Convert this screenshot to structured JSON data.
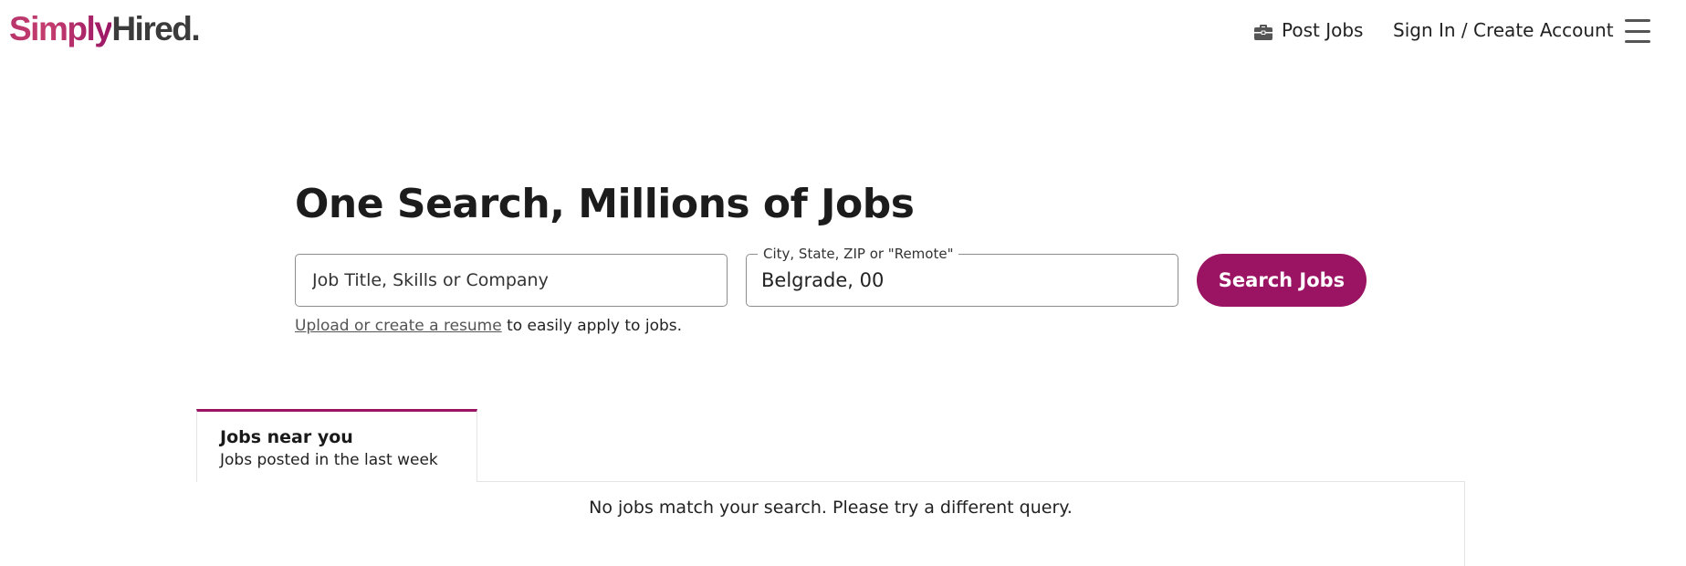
{
  "header": {
    "logo_simply": "Simply",
    "logo_hired": "Hired",
    "logo_dot": ".",
    "post_jobs": "Post Jobs",
    "sign_in": "Sign In / Create Account",
    "menu_icon": "hamburger-menu-icon",
    "briefcase_icon": "briefcase-icon"
  },
  "hero": {
    "headline": "One Search, Millions of Jobs",
    "job_input": {
      "placeholder": "Job Title, Skills or Company",
      "value": ""
    },
    "location_input": {
      "label": "City, State, ZIP or \"Remote\"",
      "value": "Belgrade, 00"
    },
    "search_button": "Search Jobs",
    "resume_link": "Upload or create a resume",
    "resume_suffix": " to easily apply to jobs."
  },
  "jobs": {
    "tab_title": "Jobs near you",
    "tab_subtitle": "Jobs posted in the last week",
    "empty_message": "No jobs match your search. Please try a different query."
  },
  "colors": {
    "brand": "#9b1464",
    "logo_gradient_start": "#b8356b",
    "text": "#1a1a1a"
  }
}
